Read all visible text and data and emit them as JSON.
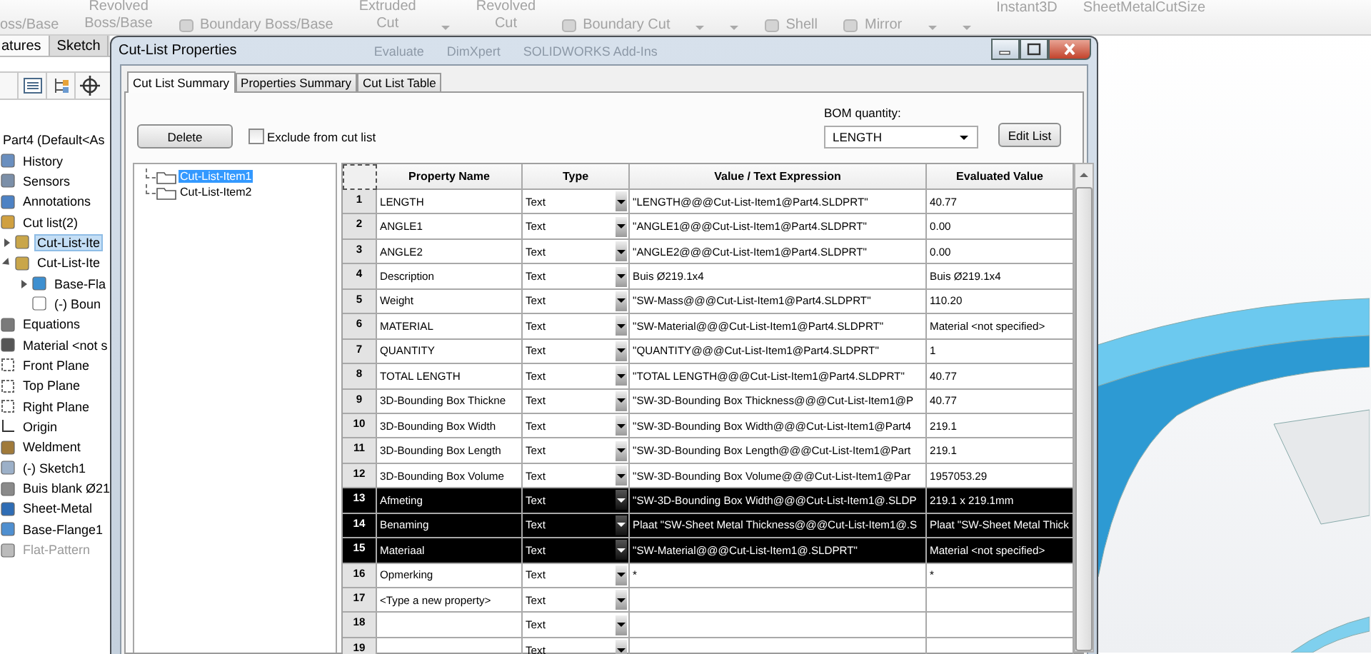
{
  "toolbar": {
    "items": [
      {
        "kind": "lower",
        "label": "oss/Base"
      },
      {
        "kind": "stacked",
        "lines": [
          "Revolved",
          "Boss/Base"
        ]
      },
      {
        "kind": "inline",
        "label": "Boundary Boss/Base"
      },
      {
        "kind": "stacked",
        "lines": [
          "Extruded",
          "Cut"
        ]
      },
      {
        "kind": "caret"
      },
      {
        "kind": "stacked",
        "lines": [
          "Revolved",
          "Cut"
        ]
      },
      {
        "kind": "inline",
        "label": "Boundary Cut"
      },
      {
        "kind": "caret"
      },
      {
        "kind": "caret"
      },
      {
        "kind": "inline",
        "label": "Shell"
      },
      {
        "kind": "inline",
        "label": "Mirror"
      },
      {
        "kind": "caret"
      },
      {
        "kind": "caret"
      },
      {
        "kind": "upper",
        "label": "Instant3D"
      },
      {
        "kind": "upper",
        "label": "SheetMetalCutSize"
      }
    ]
  },
  "feature_manager": {
    "tabs": [
      {
        "label": "atures",
        "selected": true
      },
      {
        "label": "Sketch",
        "selected": false
      }
    ],
    "tree": {
      "label": "Part4  (Default<As",
      "selected": false,
      "disabled": false,
      "children": [
        {
          "label": "History",
          "kind": "history",
          "selected": false,
          "disabled": false
        },
        {
          "label": "Sensors",
          "kind": "sensor",
          "selected": false,
          "disabled": false
        },
        {
          "label": "Annotations",
          "kind": "annotation",
          "selected": false,
          "disabled": false
        },
        {
          "label": "Cut list(2)",
          "kind": "cutlist",
          "selected": false,
          "disabled": false,
          "children": [
            {
              "label": "Cut-List-Ite",
              "kind": "cutitem",
              "selected": true,
              "disabled": false,
              "expanded": false
            },
            {
              "label": "Cut-List-Ite",
              "kind": "cutitem",
              "selected": false,
              "disabled": false,
              "expanded": true,
              "children": [
                {
                  "label": "Base-Fla",
                  "kind": "body",
                  "selected": false,
                  "disabled": false,
                  "expanded": false
                },
                {
                  "label": "(-) Boun",
                  "kind": "box3d",
                  "selected": false,
                  "disabled": false
                }
              ]
            }
          ]
        },
        {
          "label": "Equations",
          "kind": "equation",
          "selected": false,
          "disabled": false
        },
        {
          "label": "Material <not s",
          "kind": "material",
          "selected": false,
          "disabled": false
        },
        {
          "label": "Front Plane",
          "kind": "plane",
          "selected": false,
          "disabled": false
        },
        {
          "label": "Top Plane",
          "kind": "plane",
          "selected": false,
          "disabled": false
        },
        {
          "label": "Right Plane",
          "kind": "plane",
          "selected": false,
          "disabled": false
        },
        {
          "label": "Origin",
          "kind": "origin",
          "selected": false,
          "disabled": false
        },
        {
          "label": "Weldment",
          "kind": "weld",
          "selected": false,
          "disabled": false
        },
        {
          "label": "(-) Sketch1",
          "kind": "sketch",
          "selected": false,
          "disabled": false
        },
        {
          "label": "Buis blank Ø21",
          "kind": "feature",
          "selected": false,
          "disabled": false
        },
        {
          "label": "Sheet-Metal",
          "kind": "sheetmetal",
          "selected": false,
          "disabled": false
        },
        {
          "label": "Base-Flange1",
          "kind": "flange",
          "selected": false,
          "disabled": false
        },
        {
          "label": "Flat-Pattern",
          "kind": "flat",
          "selected": false,
          "disabled": true
        }
      ]
    }
  },
  "dialog": {
    "title": "Cut-List Properties",
    "background_tabs": [
      "Evaluate",
      "DimXpert",
      "SOLIDWORKS Add-Ins"
    ],
    "tabs": [
      {
        "label": "Cut List Summary",
        "selected": true
      },
      {
        "label": "Properties Summary",
        "selected": false
      },
      {
        "label": "Cut List Table",
        "selected": false
      }
    ],
    "delete_button": "Delete",
    "exclude": {
      "label": "Exclude from cut list",
      "checked": false
    },
    "bom_quantity": {
      "label": "BOM quantity:",
      "value": "LENGTH"
    },
    "edit_list_button": "Edit List",
    "items": [
      {
        "label": "Cut-List-Item1",
        "selected": true
      },
      {
        "label": "Cut-List-Item2",
        "selected": false
      }
    ],
    "table": {
      "columns": [
        "Property Name",
        "Type",
        "Value / Text Expression",
        "Evaluated Value"
      ],
      "rows": [
        {
          "number": "1",
          "name": "LENGTH",
          "type": "Text",
          "value": "\"LENGTH@@@Cut-List-Item1@Part4.SLDPRT\"",
          "evaluated": "40.77",
          "selected": false
        },
        {
          "number": "2",
          "name": "ANGLE1",
          "type": "Text",
          "value": "\"ANGLE1@@@Cut-List-Item1@Part4.SLDPRT\"",
          "evaluated": "0.00",
          "selected": false
        },
        {
          "number": "3",
          "name": "ANGLE2",
          "type": "Text",
          "value": "\"ANGLE2@@@Cut-List-Item1@Part4.SLDPRT\"",
          "evaluated": "0.00",
          "selected": false
        },
        {
          "number": "4",
          "name": "Description",
          "type": "Text",
          "value": "Buis Ø219.1x4",
          "evaluated": "Buis Ø219.1x4",
          "selected": false
        },
        {
          "number": "5",
          "name": "Weight",
          "type": "Text",
          "value": "\"SW-Mass@@@Cut-List-Item1@Part4.SLDPRT\"",
          "evaluated": "110.20",
          "selected": false
        },
        {
          "number": "6",
          "name": "MATERIAL",
          "type": "Text",
          "value": "\"SW-Material@@@Cut-List-Item1@Part4.SLDPRT\"",
          "evaluated": "Material <not specified>",
          "selected": false
        },
        {
          "number": "7",
          "name": "QUANTITY",
          "type": "Text",
          "value": "\"QUANTITY@@@Cut-List-Item1@Part4.SLDPRT\"",
          "evaluated": "1",
          "selected": false
        },
        {
          "number": "8",
          "name": "TOTAL LENGTH",
          "type": "Text",
          "value": "\"TOTAL LENGTH@@@Cut-List-Item1@Part4.SLDPRT\"",
          "evaluated": "40.77",
          "selected": false
        },
        {
          "number": "9",
          "name": "3D-Bounding Box Thickne",
          "type": "Text",
          "value": "\"SW-3D-Bounding Box Thickness@@@Cut-List-Item1@P",
          "evaluated": "40.77",
          "selected": false
        },
        {
          "number": "10",
          "name": "3D-Bounding Box Width",
          "type": "Text",
          "value": "\"SW-3D-Bounding Box Width@@@Cut-List-Item1@Part4",
          "evaluated": "219.1",
          "selected": false
        },
        {
          "number": "11",
          "name": "3D-Bounding Box Length",
          "type": "Text",
          "value": "\"SW-3D-Bounding Box Length@@@Cut-List-Item1@Part",
          "evaluated": "219.1",
          "selected": false
        },
        {
          "number": "12",
          "name": "3D-Bounding Box Volume",
          "type": "Text",
          "value": "\"SW-3D-Bounding Box Volume@@@Cut-List-Item1@Par",
          "evaluated": "1957053.29",
          "selected": false
        },
        {
          "number": "13",
          "name": "Afmeting",
          "type": "Text",
          "value": "\"SW-3D-Bounding Box Width@@@Cut-List-Item1@.SLDP",
          "evaluated": "219.1 x 219.1mm",
          "selected": true
        },
        {
          "number": "14",
          "name": "Benaming",
          "type": "Text",
          "value": "Plaat \"SW-Sheet Metal Thickness@@@Cut-List-Item1@.S",
          "evaluated": "Plaat \"SW-Sheet Metal Thick",
          "selected": true
        },
        {
          "number": "15",
          "name": "Materiaal",
          "type": "Text",
          "value": "\"SW-Material@@@Cut-List-Item1@.SLDPRT\"",
          "evaluated": "Material <not specified>",
          "selected": true
        },
        {
          "number": "16",
          "name": "Opmerking",
          "type": "Text",
          "value": "*",
          "evaluated": "*",
          "selected": false
        },
        {
          "number": "17",
          "name": "<Type a new property>",
          "type": "Text",
          "selected": false
        },
        {
          "number": "18",
          "type": "Text",
          "selected": false
        },
        {
          "number": "19",
          "type": "Text",
          "selected": false
        }
      ]
    }
  }
}
